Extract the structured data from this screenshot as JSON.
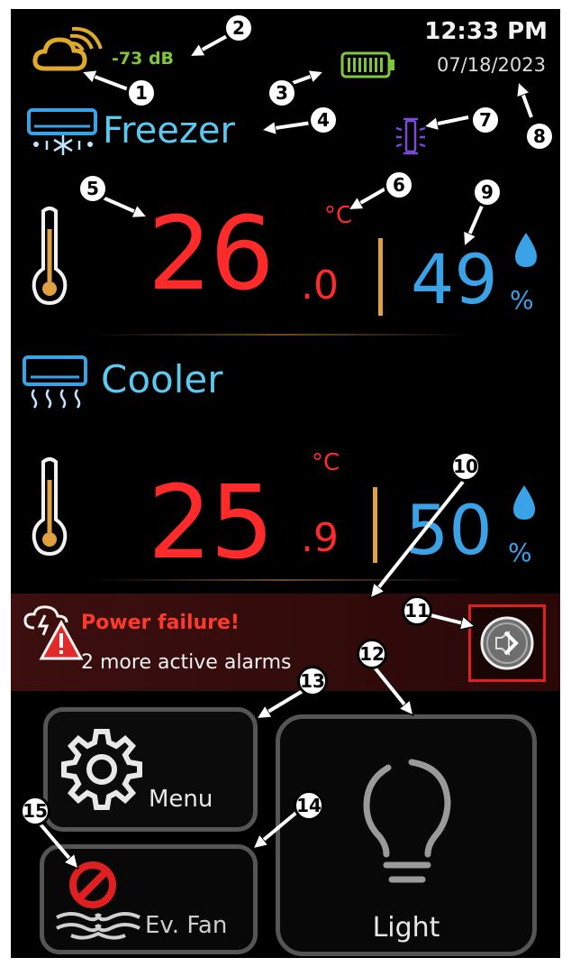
{
  "status": {
    "signal": "-73 dB",
    "time": "12:33 PM",
    "date": "07/18/2023",
    "icons": [
      "cloud-wifi-icon",
      "battery-icon",
      "defrost-bulb-icon"
    ]
  },
  "freezer": {
    "label": "Freezer",
    "temp_int": "26",
    "temp_dec": ".0",
    "unit": "°C",
    "humidity": "49",
    "humidity_unit": "%"
  },
  "cooler": {
    "label": "Cooler",
    "temp_int": "25",
    "temp_dec": ".9",
    "unit": "°C",
    "humidity": "50",
    "humidity_unit": "%"
  },
  "alarm": {
    "title": "Power failure!",
    "subtitle": "2 more active alarms"
  },
  "buttons": {
    "menu": "Menu",
    "fan": "Ev. Fan",
    "light": "Light"
  },
  "callouts": [
    "1",
    "2",
    "3",
    "4",
    "5",
    "6",
    "7",
    "8",
    "9",
    "10",
    "11",
    "12",
    "13",
    "14",
    "15"
  ],
  "colors": {
    "temp": "#ff2a2a",
    "humidity": "#3aa3e8",
    "label": "#5bc8ef",
    "signal": "#7ec63a",
    "alarm_bg": "#3a0c0c",
    "accent": "#e0a040"
  }
}
